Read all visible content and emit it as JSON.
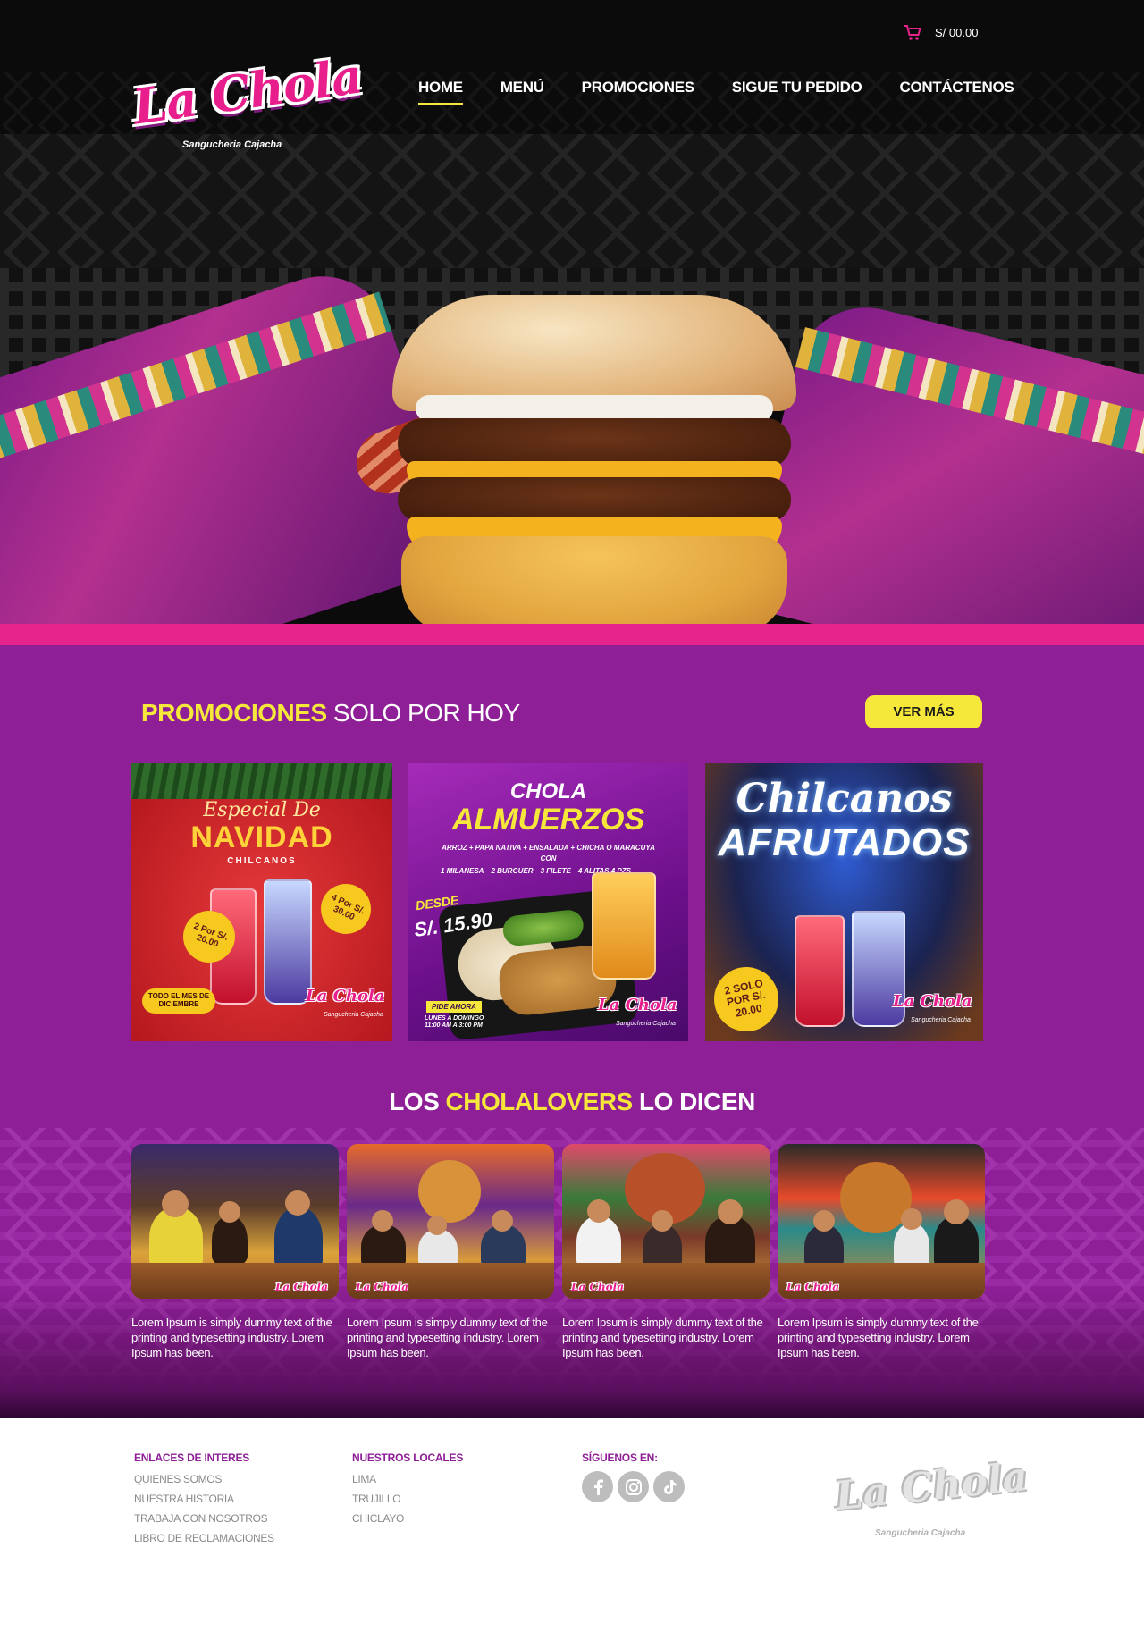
{
  "header": {
    "cart_total": "S/ 00.00",
    "logo_text": "La Chola",
    "logo_subtitle": "Sangucheria Cajacha",
    "nav": [
      {
        "label": "HOME",
        "active": true
      },
      {
        "label": "MENÚ",
        "active": false
      },
      {
        "label": "PROMOCIONES",
        "active": false
      },
      {
        "label": "SIGUE TU PEDIDO",
        "active": false
      },
      {
        "label": "CONTÁCTENOS",
        "active": false
      }
    ]
  },
  "colors": {
    "accent_yellow": "#f5e83a",
    "brand_pink": "#e5238a",
    "brand_purple": "#8e1f97"
  },
  "promotions": {
    "title_highlight": "PROMOCIONES",
    "title_rest": "SOLO POR HOY",
    "see_more": "VER MÁS",
    "cards": [
      {
        "top_script": "Especial De",
        "title": "NAVIDAD",
        "subtitle": "CHILCANOS",
        "badge_left": "2 Por S/. 20.00",
        "badge_right": "4 Por S/. 30.00",
        "note": "TODO EL MES DE DICIEMBRE",
        "logo": "La Chola",
        "logo_sub": "Sangucheria Cajacha"
      },
      {
        "title_top": "CHOLA",
        "title": "ALMUERZOS",
        "line1": "ARROZ + PAPA NATIVA + ENSALADA + CHICHA O MARACUYA",
        "line2": "CON",
        "options": [
          "1 MILANESA",
          "2 BURGUER",
          "3 FILETE",
          "4 ALITAS 4 PZS"
        ],
        "price_label": "DESDE",
        "price": "S/. 15.90",
        "order_label": "PIDE AHORA",
        "hours": "LUNES A DOMINGO 11:00 AM A 3:00 PM",
        "logo": "La Chola",
        "logo_sub": "Sangucheria Cajacha"
      },
      {
        "title_script": "Chilcanos",
        "title": "AFRUTADOS",
        "badge": "2 SOLO POR S/. 20.00",
        "logo": "La Chola",
        "logo_sub": "Sangucheria Cajacha"
      }
    ]
  },
  "lovers": {
    "title_left": "LOS",
    "title_highlight": "CHOLALOVERS",
    "title_right": "LO DICEN",
    "photo_logo": "La Chola",
    "items": [
      {
        "text": "Lorem Ipsum is simply dummy text of the printing and typesetting industry. Lorem Ipsum has been."
      },
      {
        "text": "Lorem Ipsum is simply dummy text of the printing and typesetting industry. Lorem Ipsum has been."
      },
      {
        "text": "Lorem Ipsum is simply dummy text of the printing and typesetting industry. Lorem Ipsum has been."
      },
      {
        "text": "Lorem Ipsum is simply dummy text of the printing and typesetting industry. Lorem Ipsum has been."
      }
    ]
  },
  "footer": {
    "links_title": "ENLACES DE INTERES",
    "links": [
      "QUIENES SOMOS",
      "NUESTRA HISTORIA",
      "TRABAJA CON NOSOTROS",
      "LIBRO DE  RECLAMACIONES"
    ],
    "locations_title": "NUESTROS LOCALES",
    "locations": [
      "LIMA",
      "TRUJILLO",
      "CHICLAYO"
    ],
    "social_title": "SÍGUENOS EN:",
    "social_icons": [
      "facebook-icon",
      "instagram-icon",
      "tiktok-icon"
    ],
    "logo_text": "La Chola",
    "logo_subtitle": "Sangucheria Cajacha"
  }
}
